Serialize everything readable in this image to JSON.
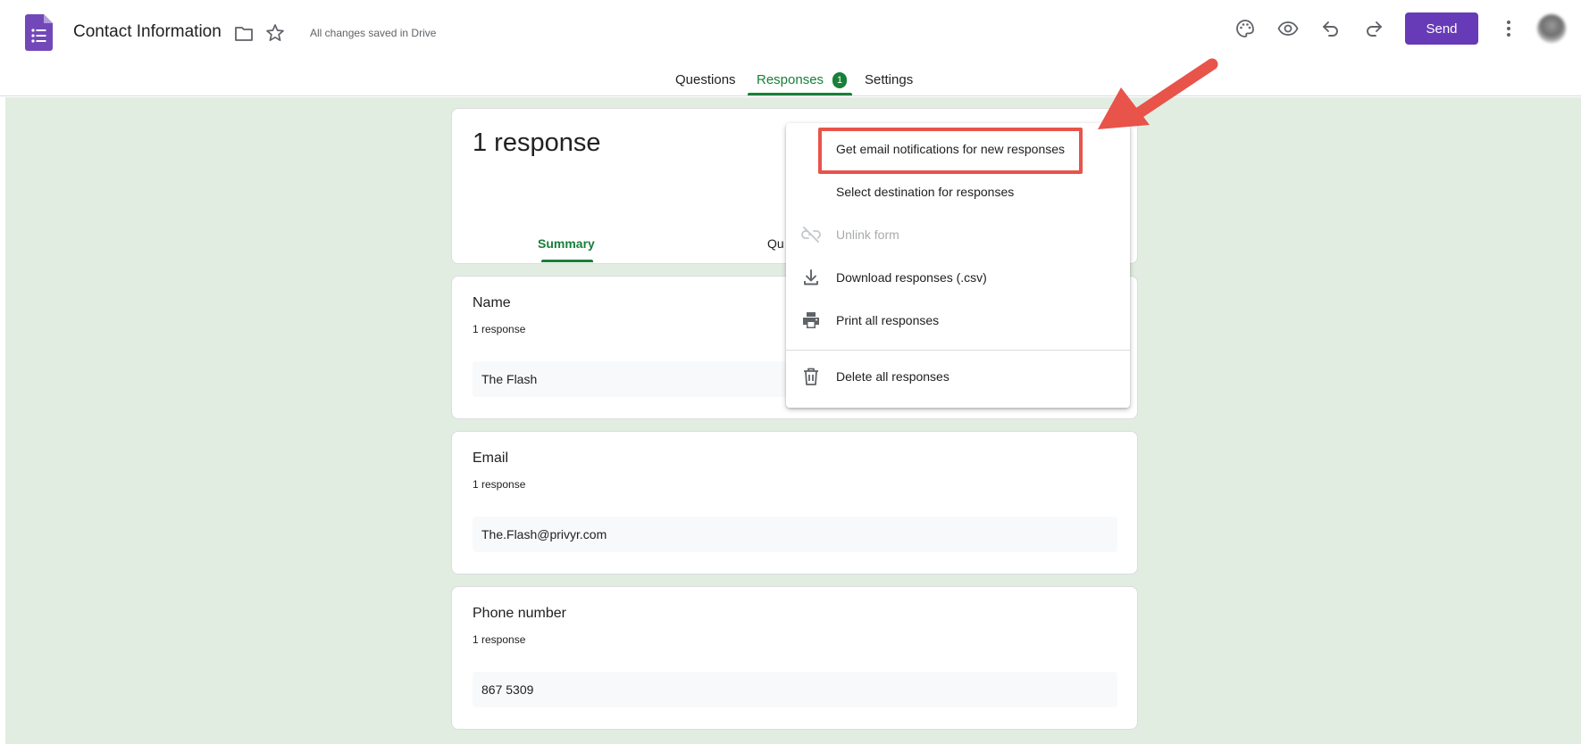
{
  "header": {
    "title": "Contact Information",
    "save_status": "All changes saved in Drive",
    "send_label": "Send"
  },
  "tabs": [
    {
      "label": "Questions"
    },
    {
      "label": "Responses",
      "badge": "1"
    },
    {
      "label": "Settings"
    }
  ],
  "summary": {
    "count_title": "1 response",
    "subtabs": [
      "Summary",
      "Qu"
    ]
  },
  "questions": [
    {
      "title": "Name",
      "count": "1 response",
      "answer": "The Flash"
    },
    {
      "title": "Email",
      "count": "1 response",
      "answer": "The.Flash@privyr.com"
    },
    {
      "title": "Phone number",
      "count": "1 response",
      "answer": "867 5309"
    }
  ],
  "menu": {
    "items": [
      {
        "label": "Get email notifications for new responses",
        "icon": "",
        "disabled": false
      },
      {
        "label": "Select destination for responses",
        "icon": "",
        "disabled": false
      },
      {
        "label": "Unlink form",
        "icon": "unlink-icon",
        "disabled": true
      },
      {
        "label": "Download responses (.csv)",
        "icon": "download-icon",
        "disabled": false
      },
      {
        "label": "Print all responses",
        "icon": "printer-icon",
        "disabled": false
      },
      {
        "label": "Delete all responses",
        "icon": "trash-icon",
        "disabled": false
      }
    ]
  },
  "colors": {
    "accent_purple": "#673ab7",
    "accent_green": "#188038",
    "background_green": "#e2ede2",
    "annotation_red": "#e8534a"
  }
}
